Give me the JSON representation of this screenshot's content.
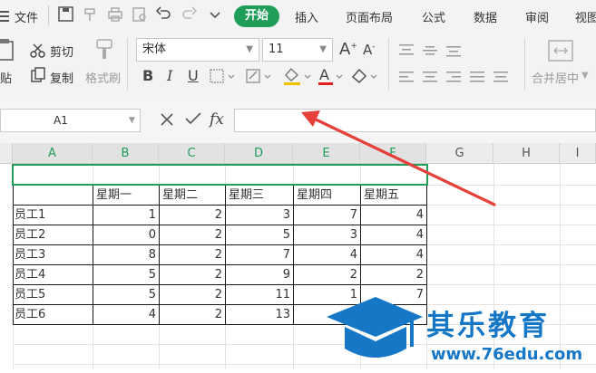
{
  "menu": {
    "file": "文件",
    "tabs": [
      "开始",
      "插入",
      "页面布局",
      "公式",
      "数据",
      "审阅",
      "视图"
    ]
  },
  "ribbon": {
    "paste": "贴",
    "cut": "剪切",
    "copy": "复制",
    "format_painter": "格式刷",
    "font_name": "宋体",
    "font_size": "11",
    "merge_center": "合并居中"
  },
  "formula_bar": {
    "cell_ref": "A1",
    "fx": "fx",
    "value": ""
  },
  "sheet": {
    "columns": [
      "A",
      "B",
      "C",
      "D",
      "E",
      "F",
      "G",
      "H",
      "I"
    ],
    "header_row": [
      "",
      "星期一",
      "星期二",
      "星期三",
      "星期四",
      "星期五"
    ],
    "rows": [
      {
        "label": "员工1",
        "values": [
          "1",
          "2",
          "3",
          "7",
          "4"
        ]
      },
      {
        "label": "员工2",
        "values": [
          "0",
          "2",
          "5",
          "3",
          "4"
        ]
      },
      {
        "label": "员工3",
        "values": [
          "8",
          "2",
          "7",
          "4",
          "4"
        ]
      },
      {
        "label": "员工4",
        "values": [
          "5",
          "2",
          "9",
          "2",
          "2"
        ]
      },
      {
        "label": "员工5",
        "values": [
          "5",
          "2",
          "11",
          "1",
          "7"
        ]
      },
      {
        "label": "员工6",
        "values": [
          "4",
          "2",
          "13",
          "",
          ""
        ]
      }
    ]
  },
  "watermark": {
    "text": "其乐教育",
    "url": "www.76edu.com"
  },
  "colors": {
    "accent": "#1e9e58",
    "arrow": "#e5403a",
    "watermark": "#1677c7"
  }
}
